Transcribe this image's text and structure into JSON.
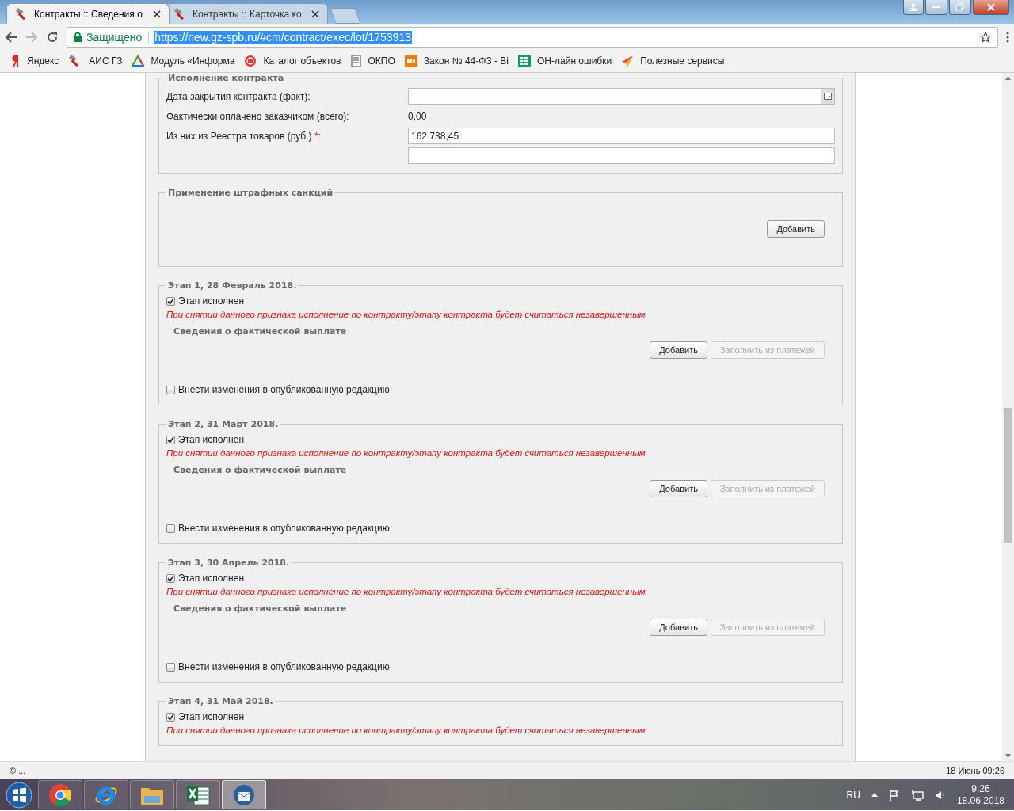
{
  "browser": {
    "tabs": [
      {
        "title": "Контракты :: Сведения о",
        "selected": true
      },
      {
        "title": "Контракты :: Карточка ко",
        "selected": false
      }
    ],
    "security_label": "Защищено",
    "url": "https://new.gz-spb.ru/#cm/contract/exec/lot/1753913",
    "bookmarks": [
      {
        "label": "Яндекс",
        "kind": "yandex"
      },
      {
        "label": "АИС ГЗ",
        "kind": "hammer"
      },
      {
        "label": "Модуль «Информа",
        "kind": "triangle"
      },
      {
        "label": "Каталог объектов",
        "kind": "seal"
      },
      {
        "label": "ОКПО",
        "kind": "doc"
      },
      {
        "label": "Закон № 44-ФЗ - Ві",
        "kind": "video"
      },
      {
        "label": "ОН-лайн ошибки",
        "kind": "sheet"
      },
      {
        "label": "Полезные сервисы",
        "kind": "arrow"
      }
    ]
  },
  "contract_execution": {
    "title": "Исполнение контракта",
    "fields": [
      {
        "kind": "date",
        "label": "Дата закрытия контракта (факт):"
      },
      {
        "kind": "text",
        "label": "Фактически оплачено заказчиком (всего):",
        "value": "0,00"
      },
      {
        "kind": "input",
        "label": "Из них из Реестра товаров (руб.) ",
        "required_mark": "*",
        "label_end": ":",
        "value": "162 738,45"
      },
      {
        "kind": "input"
      }
    ]
  },
  "penalties": {
    "title": "Применение штрафных санкций",
    "button": "Добавить"
  },
  "stages": [
    {
      "title": "Этап 1, 28 Февраль 2018.",
      "done_label": "Этап исполнен",
      "done": true,
      "warning": "При снятии данного признака исполнение по контракту/этапу контракта будет считаться незавершенным",
      "payments_title": "Сведения о фактической выплате",
      "buttons": [
        {
          "label": "Добавить",
          "disabled": false
        },
        {
          "label": "Заполнить из платежей",
          "disabled": true
        }
      ],
      "edit_label": "Внести изменения в опубликованную редакцию",
      "edit": false
    },
    {
      "title": "Этап 2, 31 Март 2018.",
      "done_label": "Этап исполнен",
      "done": true,
      "warning": "При снятии данного признака исполнение по контракту/этапу контракта будет считаться незавершенным",
      "payments_title": "Сведения о фактической выплате",
      "buttons": [
        {
          "label": "Добавить",
          "disabled": false
        },
        {
          "label": "Заполнить из платежей",
          "disabled": true
        }
      ],
      "edit_label": "Внести изменения в опубликованную редакцию",
      "edit": false
    },
    {
      "title": "Этап 3, 30 Апрель 2018.",
      "done_label": "Этап исполнен",
      "done": true,
      "warning": "При снятии данного признака исполнение по контракту/этапу контракта будет считаться незавершенным",
      "payments_title": "Сведения о фактической выплате",
      "buttons": [
        {
          "label": "Добавить",
          "disabled": false
        },
        {
          "label": "Заполнить из платежей",
          "disabled": true
        }
      ],
      "edit_label": "Внести изменения в опубликованную редакцию",
      "edit": false
    },
    {
      "title": "Этап 4, 31 Май 2018.",
      "done_label": "Этап исполнен",
      "done": true,
      "warning": "При снятии данного признака исполнение по контракту/этапу контракта будет считаться незавершенным"
    }
  ],
  "status_bar": {
    "left": "© ...",
    "right": "18 Июнь 09:26"
  },
  "taskbar": {
    "apps": [
      {
        "kind": "chrome",
        "selected": false
      },
      {
        "kind": "ie",
        "selected": false
      },
      {
        "kind": "folder",
        "selected": false
      },
      {
        "kind": "excel",
        "selected": false
      },
      {
        "kind": "mail",
        "selected": true
      }
    ],
    "language": "RU",
    "time": "9:26",
    "date": "18.06.2018"
  }
}
